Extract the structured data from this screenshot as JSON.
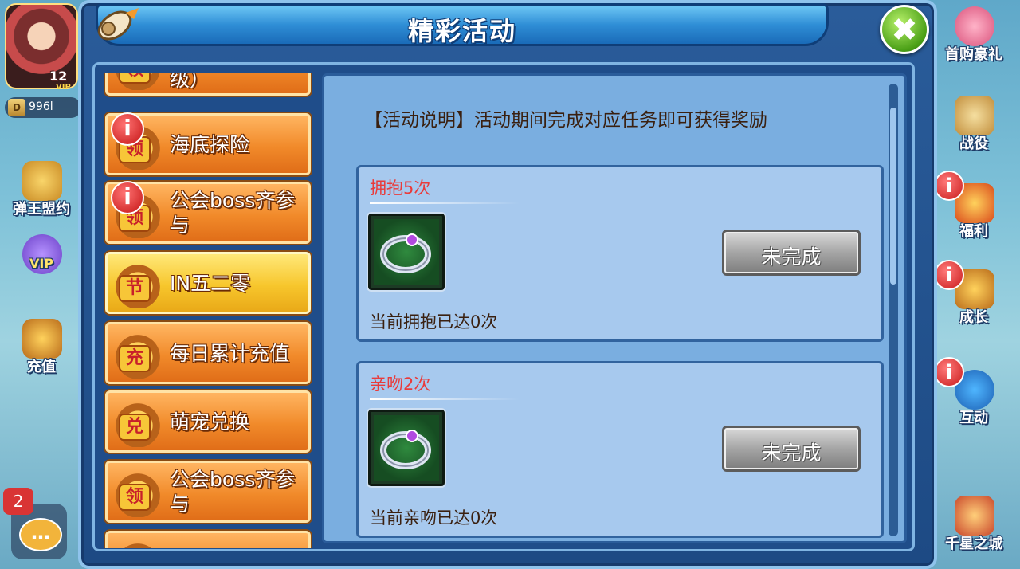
{
  "player": {
    "vip_level": "12",
    "vip_label": "VIP",
    "currency_icon": "D",
    "currency_amount": "996l"
  },
  "left_hud": [
    {
      "label": "弹王盟约"
    },
    {
      "label": "VIP"
    },
    {
      "label": "充值"
    }
  ],
  "right_hud": [
    {
      "label": "首购豪礼",
      "badge": ""
    },
    {
      "label": "战役",
      "badge": ""
    },
    {
      "label": "福利",
      "badge": "i"
    },
    {
      "label": "成长",
      "badge": "i"
    },
    {
      "label": "互动",
      "badge": "i"
    },
    {
      "label": "千星之城",
      "badge": ""
    }
  ],
  "chat": {
    "count": "2",
    "icon": "…"
  },
  "dialog": {
    "title": "精彩活动",
    "close_symbol": "✖"
  },
  "menu": {
    "items": [
      {
        "label": "级）",
        "icon_tag": "领",
        "badge": "",
        "selected": false
      },
      {
        "label": "海底探险",
        "icon_tag": "领",
        "badge": "i",
        "selected": false
      },
      {
        "label": "公会boss齐参与",
        "icon_tag": "领",
        "badge": "i",
        "selected": false
      },
      {
        "label": "IN五二零",
        "icon_tag": "节",
        "badge": "",
        "selected": true
      },
      {
        "label": "每日累计充值",
        "icon_tag": "充",
        "badge": "",
        "selected": false
      },
      {
        "label": "萌宠兑换",
        "icon_tag": "兑",
        "badge": "",
        "selected": false
      },
      {
        "label": "公会boss齐参与",
        "icon_tag": "领",
        "badge": "",
        "selected": false
      },
      {
        "label": "",
        "icon_tag": "",
        "badge": "",
        "selected": false
      }
    ]
  },
  "content": {
    "description": "【活动说明】活动期间完成对应任务即可获得奖励",
    "tasks": [
      {
        "title": "拥抱5次",
        "reward_icon": "ring-icon",
        "progress": "当前拥抱已达0次",
        "status": "未完成"
      },
      {
        "title": "亲吻2次",
        "reward_icon": "ring-icon",
        "progress": "当前亲吻已达0次",
        "status": "未完成"
      }
    ]
  }
}
